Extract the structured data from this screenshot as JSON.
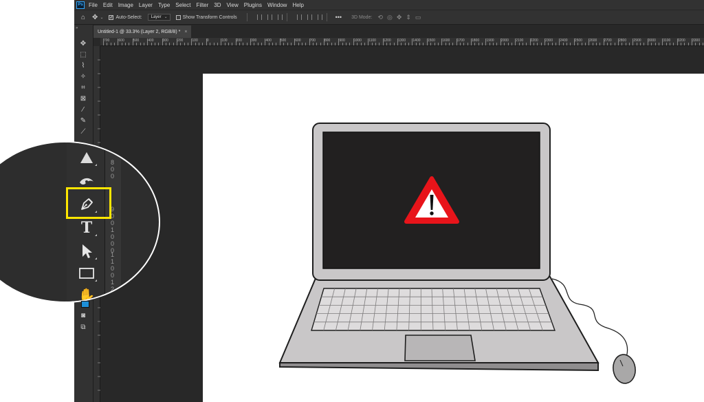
{
  "app": {
    "logo": "Ps",
    "menu": [
      "File",
      "Edit",
      "Image",
      "Layer",
      "Type",
      "Select",
      "Filter",
      "3D",
      "View",
      "Plugins",
      "Window",
      "Help"
    ]
  },
  "options_bar": {
    "auto_select_label": "Auto-Select:",
    "auto_select_value": "Layer",
    "show_transform_label": "Show Transform Controls",
    "mode_3d_label": "3D Mode:"
  },
  "document_tab": {
    "title": "Untitled-1 @ 33.3% (Layer 2, RGB/8) *",
    "close": "×"
  },
  "ruler": {
    "horizontal_labels": [
      "700",
      "600",
      "500",
      "400",
      "300",
      "200",
      "100",
      "0",
      "100",
      "200",
      "300",
      "400",
      "500",
      "600",
      "700",
      "800",
      "900",
      "1000",
      "1100",
      "1200",
      "1300",
      "1400",
      "1500",
      "1600",
      "1700",
      "1800",
      "1900",
      "2000",
      "2100",
      "2200",
      "2300",
      "2400",
      "2500",
      "2600",
      "2700",
      "2800",
      "2900",
      "3000",
      "3100",
      "3200",
      "3300"
    ],
    "magnified_labels": [
      "8",
      "0",
      "0",
      "9",
      "0",
      "0",
      "1",
      "0",
      "0",
      "0",
      "1",
      "1",
      "0",
      "0",
      "1",
      "2",
      "0",
      "0"
    ]
  },
  "tools": {
    "highlighted": "pen-tool",
    "magnified": [
      "triangle-shape-tool",
      "eye-tool",
      "pen-tool",
      "type-tool",
      "path-selection-tool",
      "rectangle-tool",
      "hand-tool"
    ]
  },
  "colors": {
    "highlight": "#ffe600",
    "foreground_swatch": "#1e8fd8",
    "warning_red": "#e8141a",
    "laptop_gray": "#c9c7c8",
    "screen_black": "#222020"
  }
}
